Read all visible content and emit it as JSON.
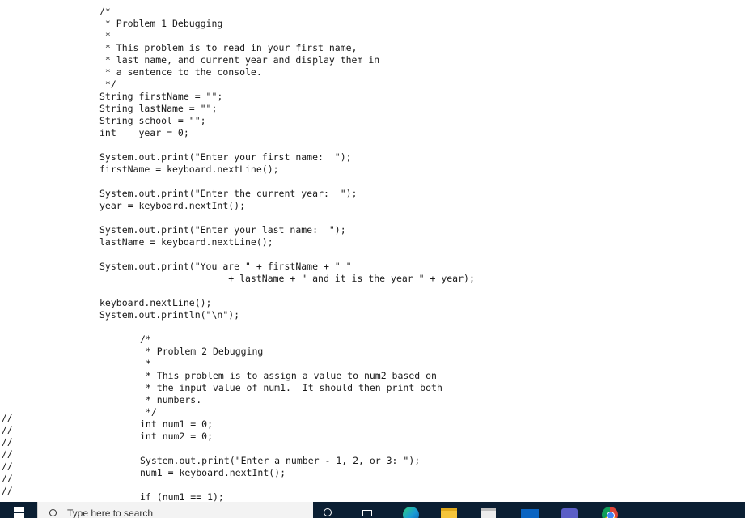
{
  "editor": {
    "lines": [
      {
        "text": "/*"
      },
      {
        "text": " * Problem 1 Debugging"
      },
      {
        "text": " *"
      },
      {
        "text": " * This problem is to read in your first name,"
      },
      {
        "text": " * last name, and current year and display them in"
      },
      {
        "text": " * a sentence to the console."
      },
      {
        "text": " */"
      },
      {
        "text": "String firstName = \"\";"
      },
      {
        "text": "String lastName = \"\";"
      },
      {
        "text": "String school = \"\";"
      },
      {
        "text": "int    year = 0;"
      },
      {
        "text": ""
      },
      {
        "text": "System.out.print(\"Enter your first name:  \");"
      },
      {
        "text": "firstName = keyboard.nextLine();"
      },
      {
        "text": ""
      },
      {
        "text": "System.out.print(\"Enter the current year:  \");"
      },
      {
        "text": "year = keyboard.nextInt();"
      },
      {
        "text": ""
      },
      {
        "text": "System.out.print(\"Enter your last name:  \");"
      },
      {
        "text": "lastName = keyboard.nextLine();"
      },
      {
        "text": ""
      },
      {
        "text": "System.out.print(\"You are \" + firstName + \" \""
      },
      {
        "text": "                       + lastName + \" and it is the year \" + year);"
      },
      {
        "text": ""
      },
      {
        "text": "keyboard.nextLine();"
      },
      {
        "text": "System.out.println(\"\\n\");"
      },
      {
        "text": ""
      },
      {
        "text": "/*"
      },
      {
        "text": " * Problem 2 Debugging"
      },
      {
        "text": " *"
      },
      {
        "text": " * This problem is to assign a value to num2 based on"
      },
      {
        "text": " * the input value of num1.  It should then print both"
      },
      {
        "text": " * numbers."
      },
      {
        "text": " */"
      },
      {
        "text": "int num1 = 0;"
      },
      {
        "text": "int num2 = 0;"
      },
      {
        "text": ""
      },
      {
        "text": "System.out.print(\"Enter a number - 1, 2, or 3: \");"
      },
      {
        "text": "num1 = keyboard.nextInt();"
      },
      {
        "text": ""
      },
      {
        "text": "if (num1 == 1);"
      }
    ],
    "gutter_marks": [
      "//",
      "//",
      "//",
      "//",
      "//",
      "//",
      "//"
    ]
  },
  "taskbar": {
    "search_placeholder": "Type here to search"
  }
}
